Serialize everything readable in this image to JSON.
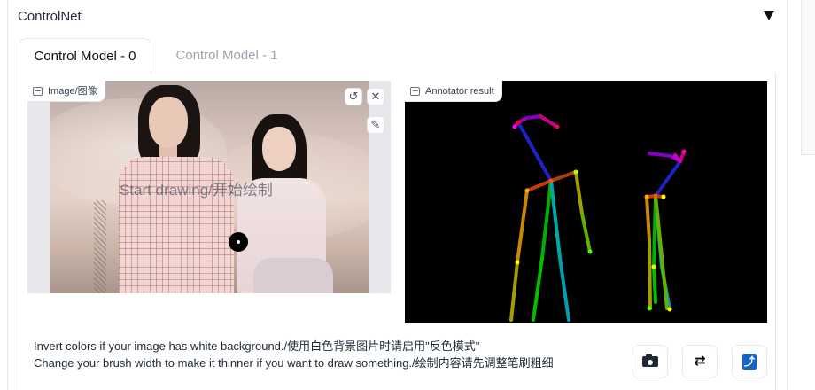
{
  "accordion": {
    "title": "ControlNet"
  },
  "tabs": [
    {
      "label": "Control Model - 0",
      "active": true
    },
    {
      "label": "Control Model - 1",
      "active": false
    }
  ],
  "image_input": {
    "label": "Image/图像",
    "icon": "image-icon",
    "canvas_hint": "Start drawing/开始绘制",
    "undo_icon": "undo-icon",
    "clear_icon": "close-icon",
    "brush_icon": "brush-icon"
  },
  "annotator": {
    "label": "Annotator result",
    "icon": "image-icon"
  },
  "notes": {
    "line1": "Invert colors if your image has white background./使用白色背景图片时请启用\"反色模式\"",
    "line2": "Change your brush width to make it thinner if you want to draw something./绘制内容请先调整笔刷粗细"
  },
  "actions": {
    "camera": "camera-icon",
    "swap": "⇄",
    "upload": "⤴"
  },
  "colors": {
    "accent_blue": "#1565c0",
    "border": "#e5e7eb",
    "inactive_tab": "#9ca3af"
  }
}
